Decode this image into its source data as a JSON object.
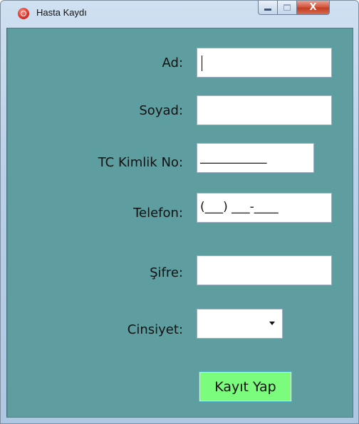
{
  "window": {
    "title": "Hasta Kaydı",
    "icon": "app-record-icon",
    "controls": {
      "minimize_icon": "minimize-icon",
      "maximize_icon": "maximize-icon",
      "close_label": "X"
    }
  },
  "form": {
    "ad": {
      "label": "Ad:",
      "value": ""
    },
    "soyad": {
      "label": "Soyad:",
      "value": ""
    },
    "tc": {
      "label": "TC Kimlik No:",
      "mask": "___________"
    },
    "telefon": {
      "label": "Telefon:",
      "mask": "(___) ___-____"
    },
    "sifre": {
      "label": "Şifre:",
      "value": ""
    },
    "cinsiyet": {
      "label": "Cinsiyet:",
      "selected": ""
    },
    "submit_label": "Kayıt Yap"
  },
  "colors": {
    "background": "#5f9ea0",
    "button": "#7cfc7c",
    "close": "#c8432a"
  }
}
